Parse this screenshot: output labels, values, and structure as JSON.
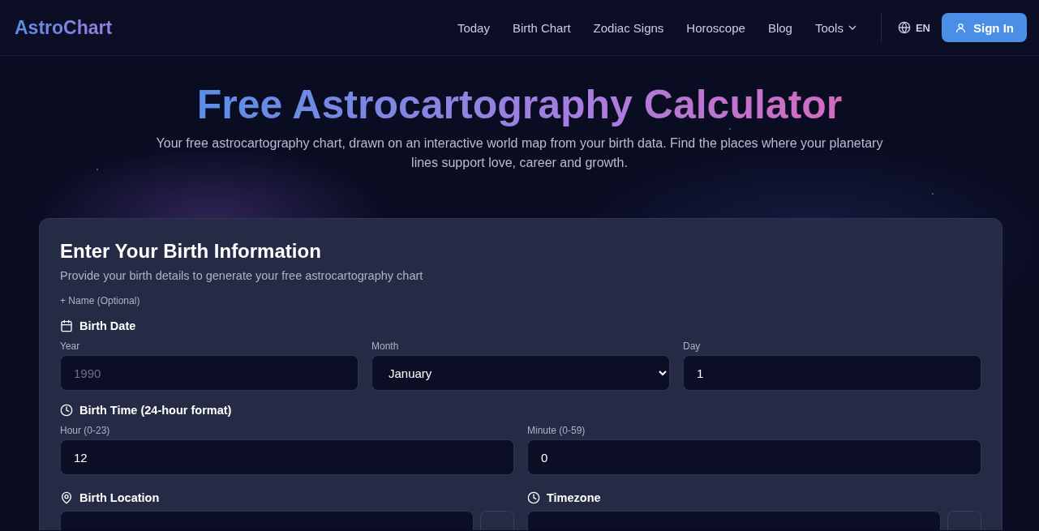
{
  "nav": {
    "brand": "AstroChart",
    "links": [
      {
        "label": "Today",
        "dropdown": false
      },
      {
        "label": "Birth Chart",
        "dropdown": false
      },
      {
        "label": "Zodiac Signs",
        "dropdown": false
      },
      {
        "label": "Horoscope",
        "dropdown": false
      },
      {
        "label": "Blog",
        "dropdown": false
      },
      {
        "label": "Tools",
        "dropdown": true
      }
    ],
    "language": "EN",
    "sign_in": "Sign In"
  },
  "hero": {
    "title": "Free Astrocartography Calculator",
    "subtitle": "Your free astrocartography chart, drawn on an interactive world map from your birth data. Find the places where your planetary lines support love, career and growth."
  },
  "form": {
    "title": "Enter Your Birth Information",
    "description": "Provide your birth details to generate your free astrocartography chart",
    "name_toggle": "+ Name (Optional)",
    "sections": [
      {
        "kind": "date",
        "heading": "Birth Date",
        "fields": [
          {
            "label": "Year",
            "kind": "input",
            "placeholder": "1990"
          },
          {
            "label": "Month",
            "kind": "select",
            "value": "January"
          },
          {
            "label": "Day",
            "kind": "input",
            "value": "1"
          }
        ]
      },
      {
        "kind": "time",
        "heading": "Birth Time (24-hour format)",
        "fields": [
          {
            "label": "Hour (0-23)",
            "kind": "input",
            "value": "12"
          },
          {
            "label": "Minute (0-59)",
            "kind": "input",
            "value": "0"
          }
        ]
      }
    ],
    "bottom_row": [
      {
        "kind": "location",
        "heading": "Birth Location"
      },
      {
        "kind": "time",
        "heading": "Timezone"
      }
    ]
  }
}
